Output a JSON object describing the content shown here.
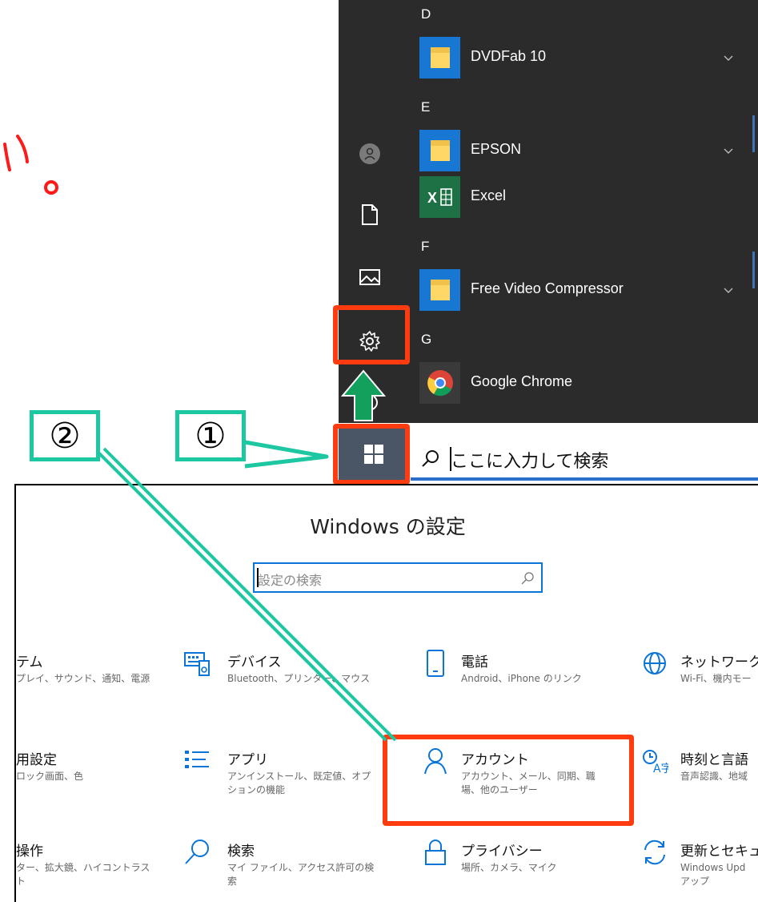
{
  "start_menu": {
    "groups": [
      {
        "letter": "D",
        "apps": [
          {
            "name": "DVDFab 10",
            "icon": "folder-icon",
            "expandable": true
          }
        ]
      },
      {
        "letter": "E",
        "apps": [
          {
            "name": "EPSON",
            "icon": "folder-icon",
            "expandable": true
          },
          {
            "name": "Excel",
            "icon": "excel-icon",
            "expandable": false
          }
        ]
      },
      {
        "letter": "F",
        "apps": [
          {
            "name": "Free Video Compressor",
            "icon": "folder-icon",
            "expandable": true
          }
        ]
      },
      {
        "letter": "G",
        "apps": [
          {
            "name": "Google Chrome",
            "icon": "chrome-icon",
            "expandable": false
          }
        ]
      }
    ],
    "rail_icons": [
      "user-icon",
      "document-icon",
      "pictures-icon",
      "gear-icon",
      "power-icon"
    ]
  },
  "taskbar": {
    "search_placeholder": "ここに入力して検索"
  },
  "callouts": {
    "step1": "①",
    "step2": "②",
    "handwriting": "い。"
  },
  "colors": {
    "highlight_red": "#ff3b10",
    "callout_green": "#1cc7a1",
    "arrow_green": "#12a05c",
    "start_bg": "#2b2b2b",
    "accent_blue": "#0a74d9"
  },
  "settings": {
    "title": "Windows の設定",
    "search_placeholder": "設定の検索",
    "tiles": [
      {
        "title": "テム",
        "desc": "プレイ、サウンド、通知、電源",
        "icon": "system-icon"
      },
      {
        "title": "デバイス",
        "desc": "Bluetooth、プリンター、マウス",
        "icon": "keyboard-icon"
      },
      {
        "title": "電話",
        "desc": "Android、iPhone のリンク",
        "icon": "phone-icon"
      },
      {
        "title": "ネットワークと",
        "desc": "Wi-Fi、機内モー",
        "icon": "globe-icon"
      },
      {
        "title": "用設定",
        "desc": "ロック画面、色",
        "icon": "personalize-icon"
      },
      {
        "title": "アプリ",
        "desc": "アンインストール、既定値、オプションの機能",
        "icon": "apps-list-icon"
      },
      {
        "title": "アカウント",
        "desc": "アカウント、メール、同期、職場、他のユーザー",
        "icon": "person-icon"
      },
      {
        "title": "時刻と言語",
        "desc": "音声認識、地域",
        "icon": "time-language-icon"
      },
      {
        "title": "操作",
        "desc": "ター、拡大鏡、ハイコントラスト",
        "icon": "ease-icon"
      },
      {
        "title": "検索",
        "desc": "マイ ファイル、アクセス許可の検索",
        "icon": "search-icon"
      },
      {
        "title": "プライバシー",
        "desc": "場所、カメラ、マイク",
        "icon": "lock-icon"
      },
      {
        "title": "更新とセキュ",
        "desc": "Windows Upd アップ",
        "icon": "update-icon"
      }
    ]
  }
}
